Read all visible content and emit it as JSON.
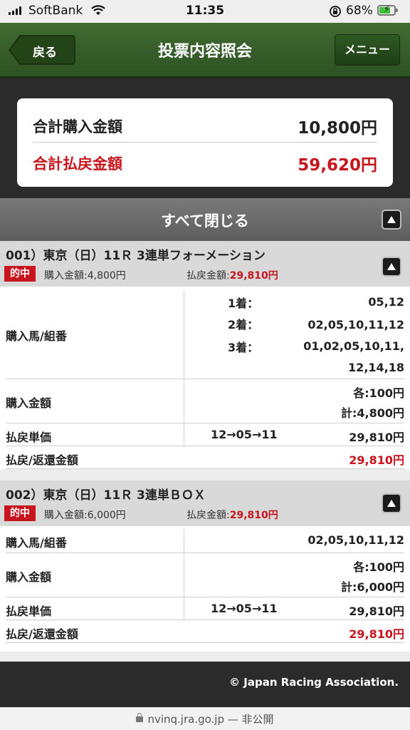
{
  "status_bar": {
    "carrier": "SoftBank",
    "time": "11:35",
    "battery_pct": "68%",
    "icons": [
      "signal-icon",
      "wifi-icon",
      "rotation-lock-icon",
      "battery-charging-icon"
    ]
  },
  "header": {
    "back_label": "戻る",
    "title": "投票内容照会",
    "menu_label": "メニュー"
  },
  "summary": {
    "purchase_label": "合計購入金額",
    "purchase_value": "10,800円",
    "payout_label": "合計払戻金額",
    "payout_value": "59,620円"
  },
  "close_all_label": "すべて閉じる",
  "bets": [
    {
      "title": "001）東京（日）11Ｒ 3連単フォーメーション",
      "badge": "的中",
      "purchase_meta": "購入金額:4,800円",
      "payout_meta_label": "払戻金額:",
      "payout_meta_value": "29,810円",
      "horses_label": "購入馬/組番",
      "place1_label": "1着：",
      "place1_value": "05,12",
      "place2_label": "2着：",
      "place2_value": "02,05,10,11,12",
      "place3_label": "3着：",
      "place3_value_line1": "01,02,05,10,11,",
      "place3_value_line2": "12,14,18",
      "amount_label": "購入金額",
      "amount_each": "各:100円",
      "amount_total": "計:4,800円",
      "unit_label": "払戻単価",
      "unit_combo": "12→05→11",
      "unit_value": "29,810円",
      "refund_label": "払戻/返還金額",
      "refund_value": "29,810円"
    },
    {
      "title": "002）東京（日）11Ｒ 3連単ＢＯＸ",
      "badge": "的中",
      "purchase_meta": "購入金額:6,000円",
      "payout_meta_label": "払戻金額:",
      "payout_meta_value": "29,810円",
      "horses_label": "購入馬/組番",
      "horses_value": "02,05,10,11,12",
      "amount_label": "購入金額",
      "amount_each": "各:100円",
      "amount_total": "計:6,000円",
      "unit_label": "払戻単価",
      "unit_combo": "12→05→11",
      "unit_value": "29,810円",
      "refund_label": "払戻/返還金額",
      "refund_value": "29,810円"
    }
  ],
  "footer": {
    "copyright": "© Japan Racing Association."
  },
  "url_bar": {
    "text": "nvinq.jra.go.jp — 非公開"
  },
  "colors": {
    "header_green": "#3a6129",
    "accent_red": "#c8141c",
    "dark_band": "#2b2b2b"
  }
}
